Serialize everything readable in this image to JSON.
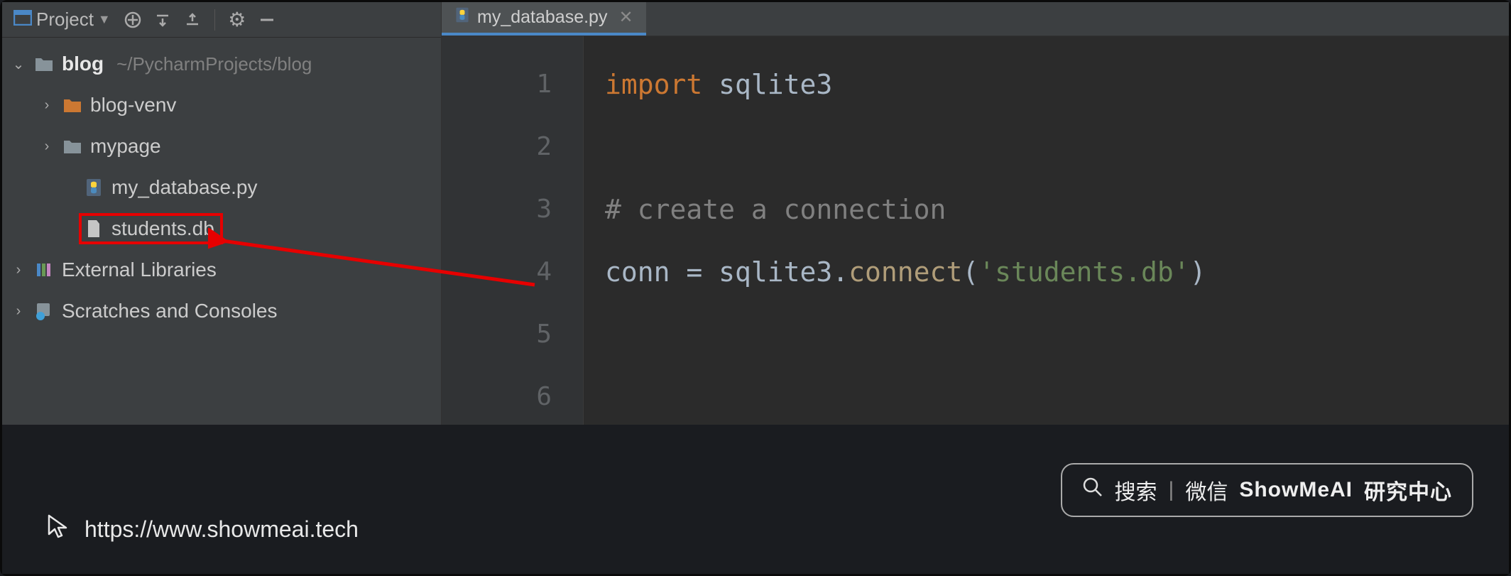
{
  "sidebar": {
    "title": "Project",
    "tree": {
      "root": {
        "name": "blog",
        "path": "~/PycharmProjects/blog"
      },
      "children": [
        {
          "name": "blog-venv",
          "type": "folder-venv"
        },
        {
          "name": "mypage",
          "type": "folder"
        },
        {
          "name": "my_database.py",
          "type": "python"
        },
        {
          "name": "students.db",
          "type": "file",
          "highlighted": true
        }
      ],
      "external": "External Libraries",
      "scratches": "Scratches and Consoles"
    }
  },
  "editor": {
    "tab": {
      "filename": "my_database.py"
    },
    "gutter": [
      "1",
      "2",
      "3",
      "4",
      "5",
      "6"
    ],
    "code": {
      "l1_kw": "import",
      "l1_mod": " sqlite3",
      "l3_cmt": "# create a connection",
      "l4_a": "conn = sqlite3.",
      "l4_fn": "connect",
      "l4_b": "(",
      "l4_str": "'students.db'",
      "l4_c": ")"
    }
  },
  "footer": {
    "url": "https://www.showmeai.tech",
    "search_label": "搜索",
    "wechat_label": "微信",
    "brand": "ShowMeAI",
    "brand_suffix": "研究中心"
  }
}
